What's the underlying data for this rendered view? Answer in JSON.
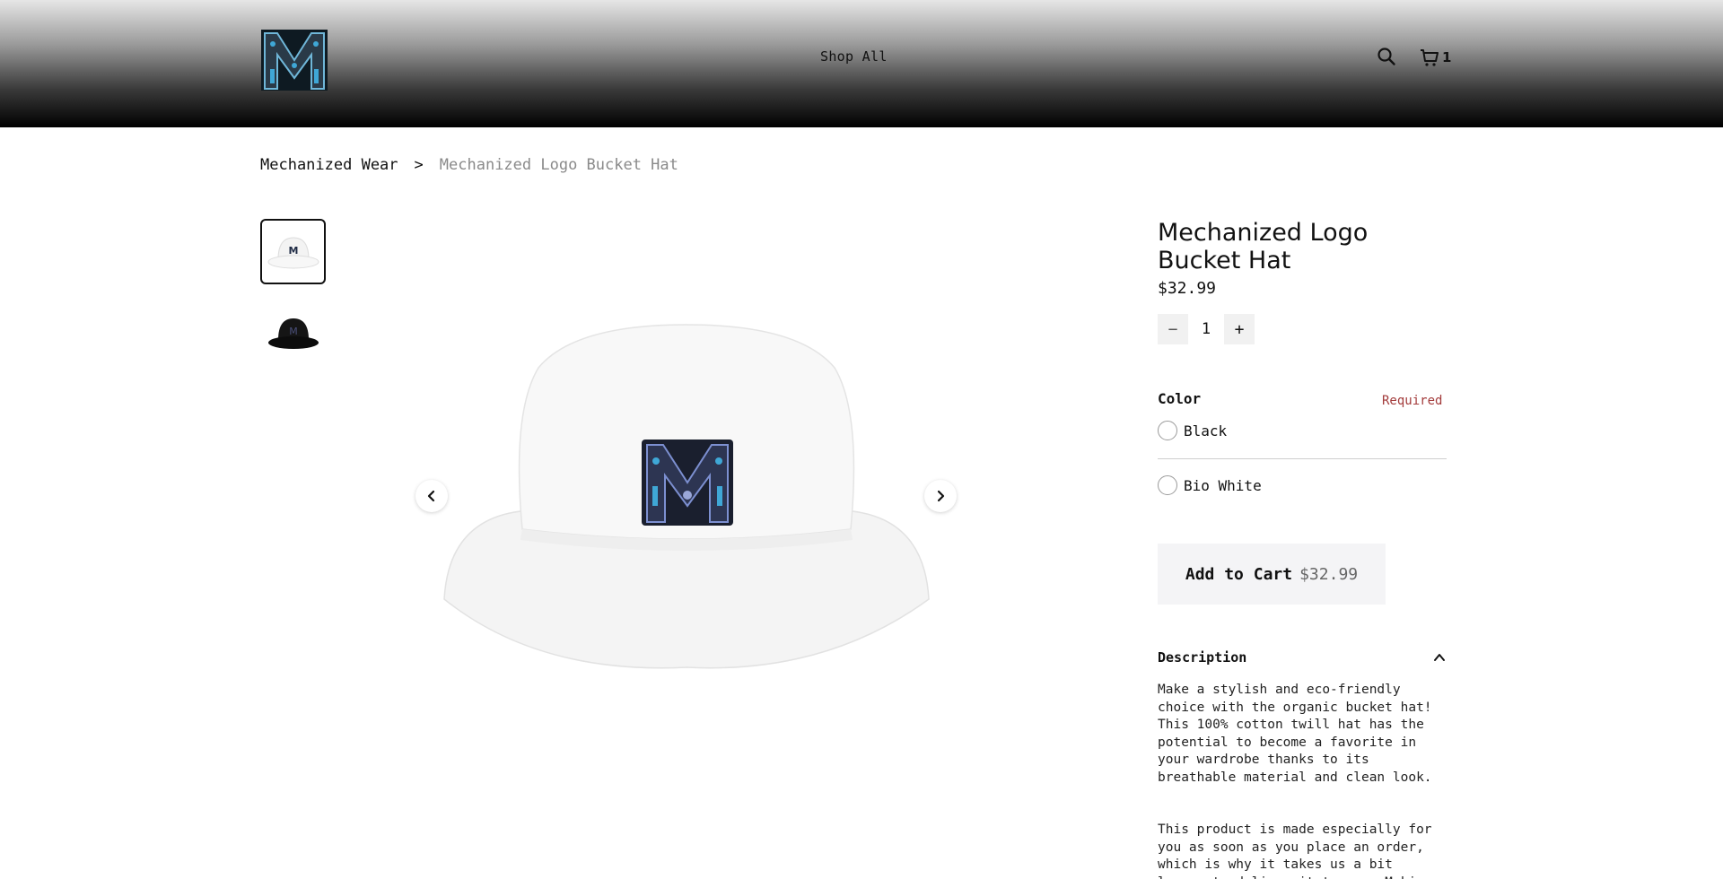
{
  "header": {
    "logo_letter": "M",
    "nav_shop_all": "Shop All",
    "cart_count": "1"
  },
  "breadcrumb": {
    "parent": "Mechanized Wear",
    "separator": ">",
    "current": "Mechanized Logo Bucket Hat"
  },
  "gallery": {
    "thumbnails": [
      {
        "name": "white hat",
        "active": true
      },
      {
        "name": "black hat",
        "active": false
      }
    ]
  },
  "product": {
    "title": "Mechanized Logo Bucket Hat",
    "price": "$32.99",
    "quantity": "1",
    "qty_minus": "−",
    "qty_plus": "+",
    "color_label": "Color",
    "required_label": "Required",
    "options": [
      "Black",
      "Bio White"
    ],
    "add_to_cart_label": "Add to Cart",
    "add_to_cart_price": "$32.99",
    "description_label": "Description",
    "description_p1": "Make a stylish and eco-friendly\nchoice with the organic bucket hat!\nThis 100% cotton twill hat has the\npotential to become a favorite in\nyour wardrobe thanks to its\nbreathable material and clean look.",
    "description_p2": "This product is made especially for\nyou as soon as you place an order,\nwhich is why it takes us a bit\nlonger to deliver it to you. Making"
  },
  "colors": {
    "required": "#a33b3b",
    "button_bg": "#f4f4f6",
    "hat_white": "#f7f7f7",
    "hat_black": "#111111",
    "logo_blue": "#3fa7d6"
  }
}
